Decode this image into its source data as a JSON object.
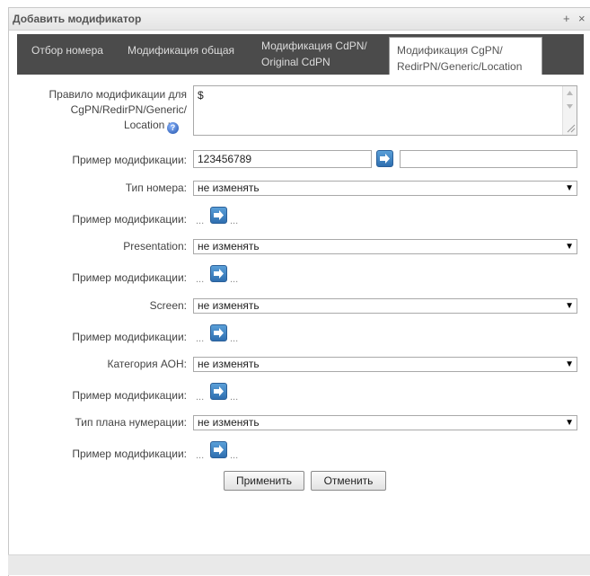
{
  "window": {
    "title": "Добавить модификатор",
    "plus_glyph": "+",
    "close_glyph": "×"
  },
  "tabs": [
    {
      "line1": "Отбор номера",
      "line2": ""
    },
    {
      "line1": "Модификация общая",
      "line2": ""
    },
    {
      "line1": "Модификация CdPN/",
      "line2": "Original CdPN"
    },
    {
      "line1": "Модификация CgPN/",
      "line2": "RedirPN/Generic/Location"
    }
  ],
  "rule": {
    "label_line1": "Правило модификации для",
    "label_line2": "CgPN/RedirPN/Generic/",
    "label_line3": "Location :",
    "value": "$"
  },
  "example_main": {
    "label": "Пример модификации:",
    "input_value": "123456789",
    "result_value": ""
  },
  "fields": [
    {
      "label": "Тип номера:",
      "value": "не изменять"
    },
    {
      "label": "Presentation:",
      "value": "не изменять"
    },
    {
      "label": "Screen:",
      "value": "не изменять"
    },
    {
      "label": "Категория АОН:",
      "value": "не изменять"
    },
    {
      "label": "Тип плана нумерации:",
      "value": "не изменять"
    }
  ],
  "example_label": "Пример модификации:",
  "dots": "...",
  "buttons": {
    "apply": "Применить",
    "cancel": "Отменить"
  },
  "icons": {
    "help": "help-icon",
    "go": "arrow-right-icon",
    "dropdown": "chevron-down-icon"
  }
}
